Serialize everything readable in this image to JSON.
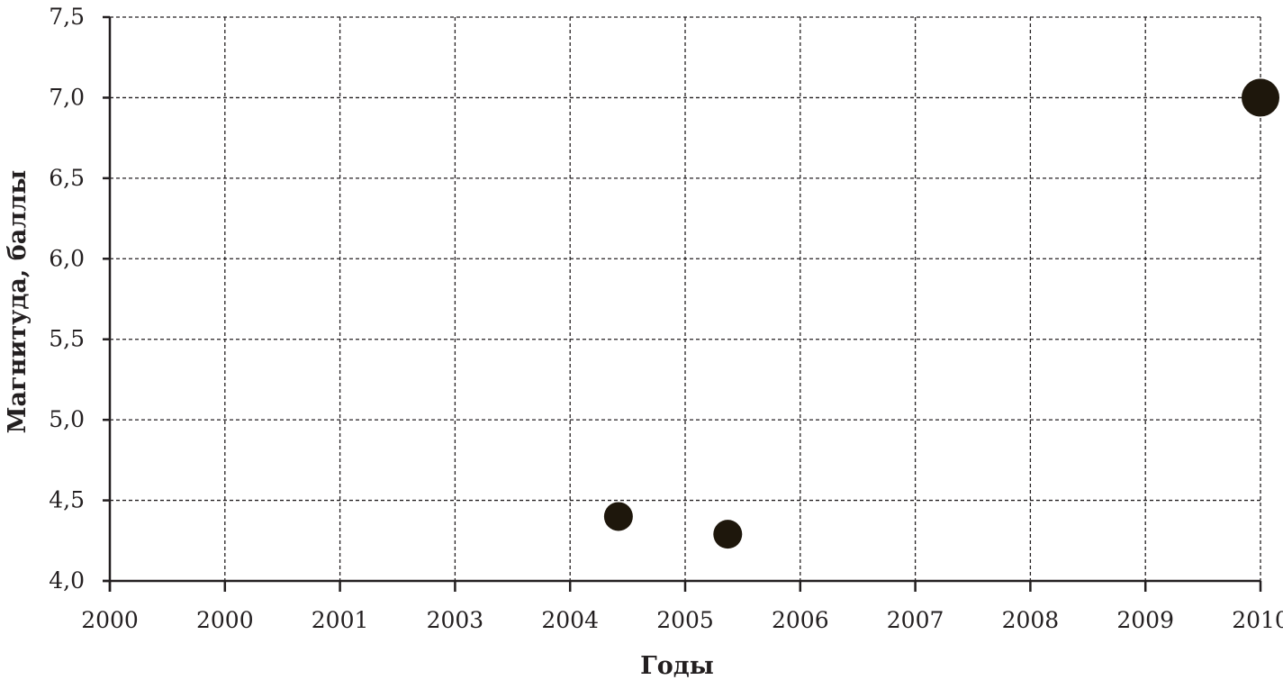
{
  "chart_data": {
    "type": "scatter",
    "xlabel": "Годы",
    "ylabel": "Магнитуда, баллы",
    "x_tick_labels": [
      "2000",
      "2000",
      "2001",
      "2003",
      "2004",
      "2005",
      "2006",
      "2007",
      "2008",
      "2009",
      "2010"
    ],
    "y_tick_labels": [
      "4,0",
      "4,5",
      "5,0",
      "5,5",
      "6,0",
      "6,5",
      "7,0",
      "7,5"
    ],
    "ylim": [
      4.0,
      7.5
    ],
    "grid": true,
    "points": [
      {
        "x": "2004 (mid)",
        "x_index": 4.42,
        "y": 4.4,
        "size": "medium"
      },
      {
        "x": "2005 (mid)",
        "x_index": 5.37,
        "y": 4.29,
        "size": "medium"
      },
      {
        "x": "2010",
        "x_index": 10.0,
        "y": 7.0,
        "size": "large"
      }
    ],
    "colors": {
      "marker": "#1e170c",
      "axis": "#231f20"
    }
  }
}
